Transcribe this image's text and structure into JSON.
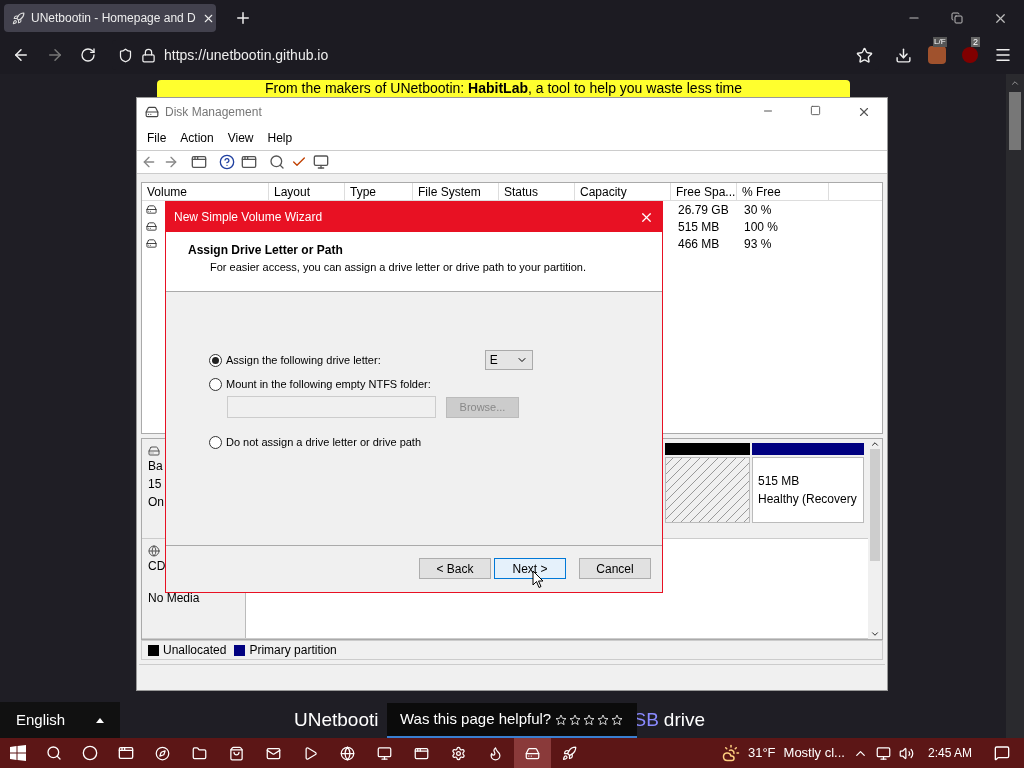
{
  "browser": {
    "tab": {
      "title": "UNetbootin - Homepage and D",
      "selected": true
    },
    "url": "https://unetbootin.github.io",
    "extension_badge": "2",
    "extension_label": "L/F"
  },
  "page": {
    "banner": "From the makers of UNetbootin: **HabitLab**, a tool to help you waste less time",
    "language": "English",
    "heading_left": "UNetbooti",
    "heading_link": "SB",
    "heading_right": "drive",
    "helpful": {
      "question": "Was this page helpful?",
      "stars": 0
    }
  },
  "disk_management": {
    "title": "Disk Management",
    "menu": [
      "File",
      "Action",
      "View",
      "Help"
    ],
    "columns": [
      "Volume",
      "Layout",
      "Type",
      "File System",
      "Status",
      "Capacity",
      "Free Spa...",
      "% Free"
    ],
    "rows": [
      {
        "free_space": "26.79 GB",
        "percent_free": "30 %"
      },
      {
        "free_space": "515 MB",
        "percent_free": "100 %"
      },
      {
        "free_space": "466 MB",
        "percent_free": "93 %"
      }
    ],
    "disks": [
      {
        "kind": "basic",
        "labels": [
          "Ba",
          "15",
          "On"
        ],
        "partitions": [
          {
            "kind": "unallocated",
            "color": "#000000"
          },
          {
            "kind": "primary",
            "color": "#000080",
            "size": "515 MB",
            "status": "Healthy (Recovery"
          }
        ]
      },
      {
        "kind": "cdrom",
        "labels": [
          "CD",
          "No Media"
        ]
      }
    ],
    "legend": [
      {
        "label": "Unallocated",
        "color": "#000000"
      },
      {
        "label": "Primary partition",
        "color": "#000080"
      }
    ]
  },
  "wizard": {
    "title": "New Simple Volume Wizard",
    "heading": "Assign Drive Letter or Path",
    "subtitle": "For easier access, you can assign a drive letter or drive path to your partition.",
    "options": [
      {
        "kind": "letter",
        "label": "Assign the following drive letter:",
        "selected": true,
        "value": "E"
      },
      {
        "kind": "folder",
        "label": "Mount in the following empty NTFS folder:",
        "selected": false,
        "button": "Browse...",
        "disabled": true
      },
      {
        "kind": "none",
        "label": "Do not assign a drive letter or drive path",
        "selected": false
      }
    ],
    "buttons": [
      {
        "label": "< Back",
        "focused": false
      },
      {
        "label": "Next >",
        "focused": true
      },
      {
        "label": "Cancel",
        "focused": false
      }
    ]
  },
  "taskbar": {
    "apps": [
      {
        "kind": "edge",
        "selected": false
      },
      {
        "kind": "folder",
        "selected": false
      },
      {
        "kind": "store",
        "selected": false
      },
      {
        "kind": "mail",
        "selected": false
      },
      {
        "kind": "media",
        "selected": false
      },
      {
        "kind": "chrome",
        "selected": false
      },
      {
        "kind": "remote",
        "selected": false
      },
      {
        "kind": "window",
        "selected": false
      },
      {
        "kind": "settings",
        "selected": false
      },
      {
        "kind": "firefox",
        "selected": false
      },
      {
        "kind": "disk",
        "selected": true
      },
      {
        "kind": "rocket",
        "selected": false
      }
    ],
    "temperature": "31°F",
    "weather": "Mostly cl...",
    "time": "2:45 AM"
  }
}
